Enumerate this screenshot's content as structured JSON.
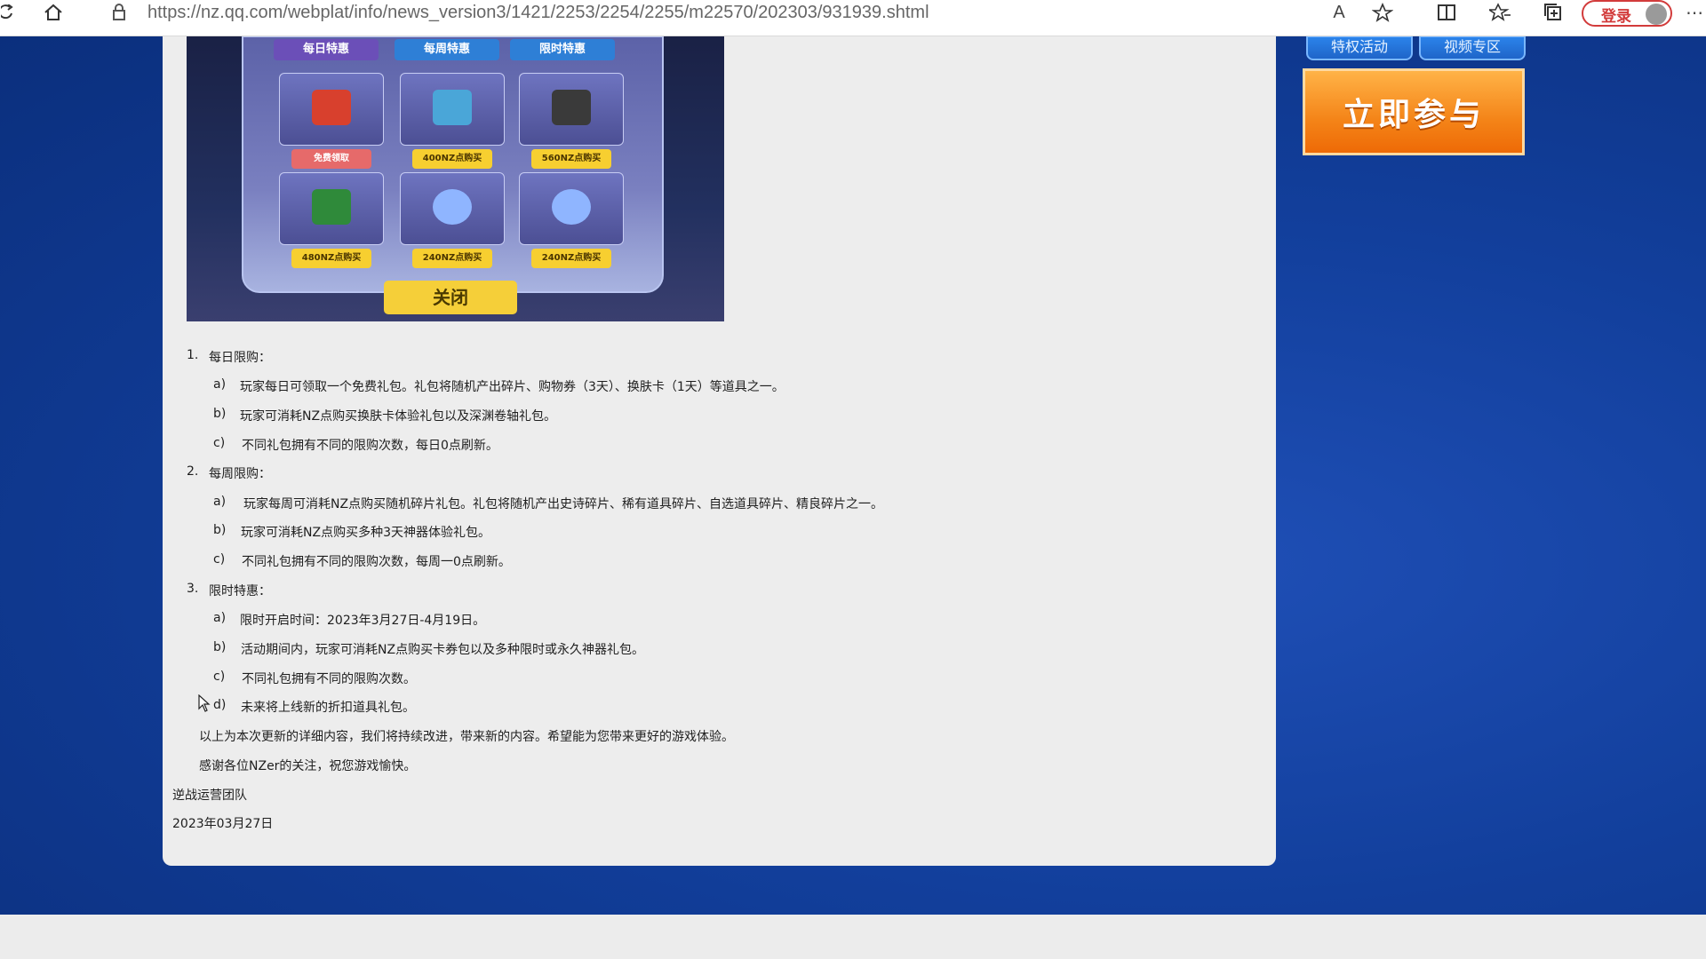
{
  "browser": {
    "url": "https://nz.qq.com/webplat/info/news_version3/1421/2253/2254/2255/m22570/202303/931939.shtml",
    "login_label": "登录",
    "icons": [
      "refresh-icon",
      "home-icon",
      "lock-icon",
      "read-aloud-icon",
      "add-favorite-icon",
      "split-screen-icon",
      "favorites-icon",
      "collections-icon",
      "more-icon"
    ]
  },
  "game_image": {
    "tabs": [
      "每日特惠",
      "每周特惠",
      "限时特惠"
    ],
    "prices": [
      "免费领取",
      "400NZ点购买",
      "560NZ点购买",
      "480NZ点购买",
      "240NZ点购买",
      "240NZ点购买"
    ],
    "close_label": "关闭"
  },
  "sections": [
    {
      "num": "1.",
      "title": "每日限购：",
      "items": [
        {
          "label": "a)",
          "text": "玩家每日可领取一个免费礼包。礼包将随机产出碎片、购物券（3天）、换肤卡（1天）等道具之一。"
        },
        {
          "label": "b)",
          "text": "玩家可消耗NZ点购买换肤卡体验礼包以及深渊卷轴礼包。"
        },
        {
          "label": "c)",
          "text": "不同礼包拥有不同的限购次数，每日0点刷新。"
        }
      ]
    },
    {
      "num": "2.",
      "title": "每周限购：",
      "items": [
        {
          "label": "a)",
          "text": "玩家每周可消耗NZ点购买随机碎片礼包。礼包将随机产出史诗碎片、稀有道具碎片、自选道具碎片、精良碎片之一。"
        },
        {
          "label": "b)",
          "text": "玩家可消耗NZ点购买多种3天神器体验礼包。"
        },
        {
          "label": "c)",
          "text": "不同礼包拥有不同的限购次数，每周一0点刷新。"
        }
      ]
    },
    {
      "num": "3.",
      "title": "限时特惠：",
      "items": [
        {
          "label": "a)",
          "text": "限时开启时间：2023年3月27日-4月19日。"
        },
        {
          "label": "b)",
          "text": "活动期间内，玩家可消耗NZ点购买卡券包以及多种限时或永久神器礼包。"
        },
        {
          "label": "c)",
          "text": "不同礼包拥有不同的限购次数。"
        },
        {
          "label": "d)",
          "text": "未来将上线新的折扣道具礼包。"
        }
      ]
    }
  ],
  "closing": [
    "以上为本次更新的详细内容，我们将持续改进，带来新的内容。希望能为您带来更好的游戏体验。",
    "感谢各位NZer的关注，祝您游戏愉快。"
  ],
  "team": "逆战运营团队",
  "date": "2023年03月27日",
  "sidebar": {
    "tab1": "特权活动",
    "tab2": "视频专区",
    "join_label": "立即参与"
  }
}
